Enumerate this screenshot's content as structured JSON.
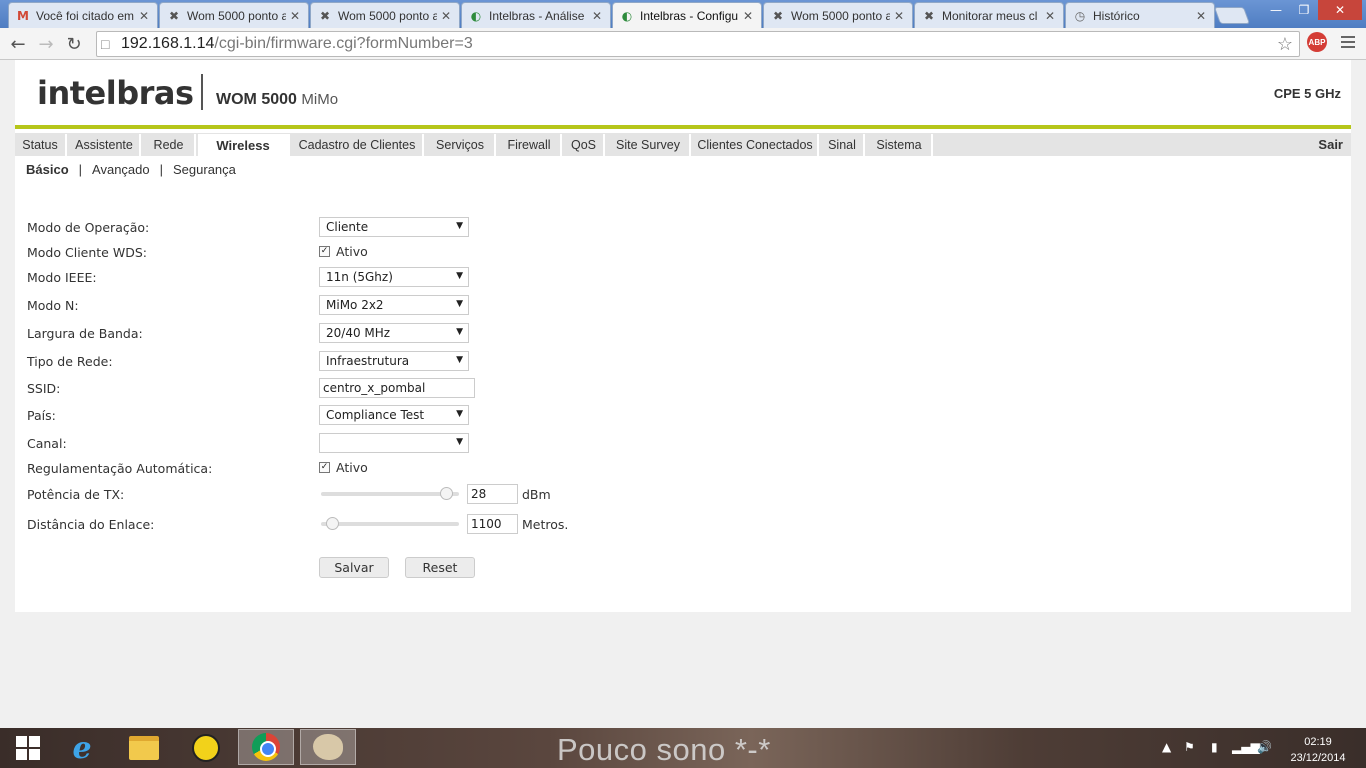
{
  "browser": {
    "tabs": [
      {
        "label": "Você foi citado em",
        "icon": "M",
        "icon_color": "#d14836",
        "active": false
      },
      {
        "label": "Wom 5000 ponto a",
        "icon": "✖",
        "icon_color": "#555555",
        "active": false
      },
      {
        "label": "Wom 5000 ponto a",
        "icon": "✖",
        "icon_color": "#555555",
        "active": false
      },
      {
        "label": "Intelbras - Análise",
        "icon": "◐",
        "icon_color": "#2e8b3c",
        "active": false
      },
      {
        "label": "Intelbras - Configu",
        "icon": "◐",
        "icon_color": "#2e8b3c",
        "active": true
      },
      {
        "label": "Wom 5000 ponto a",
        "icon": "✖",
        "icon_color": "#555555",
        "active": false
      },
      {
        "label": "Monitorar meus cl",
        "icon": "✖",
        "icon_color": "#555555",
        "active": false
      },
      {
        "label": "Histórico",
        "icon": "◷",
        "icon_color": "#666666",
        "active": false
      }
    ],
    "url_host": "192.168.1.14",
    "url_path": "/cgi-bin/firmware.cgi?formNumber=3",
    "abp_label": "ABP"
  },
  "header": {
    "logo": "intelbras",
    "product_model": "WOM 5000",
    "product_suffix": "MiMo",
    "device_type": "CPE 5 GHz"
  },
  "menu": {
    "items": [
      "Status",
      "Assistente",
      "Rede",
      "Wireless",
      "Cadastro de Clientes",
      "Serviços",
      "Firewall",
      "QoS",
      "Site Survey",
      "Clientes Conectados",
      "Sinal",
      "Sistema"
    ],
    "active": "Wireless",
    "logout": "Sair"
  },
  "submenu": {
    "items": [
      "Básico",
      "Avançado",
      "Segurança"
    ],
    "separator": "|"
  },
  "form": {
    "modo_operacao": {
      "label": "Modo de Operação:",
      "value": "Cliente"
    },
    "modo_wds": {
      "label": "Modo Cliente WDS:",
      "checked": true,
      "text": "Ativo"
    },
    "modo_ieee": {
      "label": "Modo IEEE:",
      "value": "11n (5Ghz)"
    },
    "modo_n": {
      "label": "Modo N:",
      "value": "MiMo 2x2"
    },
    "largura_banda": {
      "label": "Largura de Banda:",
      "value": "20/40 MHz"
    },
    "tipo_rede": {
      "label": "Tipo de Rede:",
      "value": "Infraestrutura"
    },
    "ssid": {
      "label": "SSID:",
      "value": "centro_x_pombal"
    },
    "pais": {
      "label": "País:",
      "value": "Compliance Test"
    },
    "canal": {
      "label": "Canal:",
      "value": ""
    },
    "regulamentacao": {
      "label": "Regulamentação Automática:",
      "checked": true,
      "text": "Ativo"
    },
    "potencia_tx": {
      "label": "Potência de TX:",
      "value": "28",
      "unit": "dBm",
      "slider_fraction": 0.95
    },
    "distancia": {
      "label": "Distância do Enlace:",
      "value": "1100",
      "unit": "Metros.",
      "slider_fraction": 0.04
    },
    "save_label": "Salvar",
    "reset_label": "Reset"
  },
  "taskbar": {
    "wallpaper_text": "Pouco sono *-*",
    "time": "02:19",
    "date": "23/12/2014"
  },
  "colors": {
    "brand_green": "#b6c61a",
    "menu_bg": "#e4e4e4"
  }
}
